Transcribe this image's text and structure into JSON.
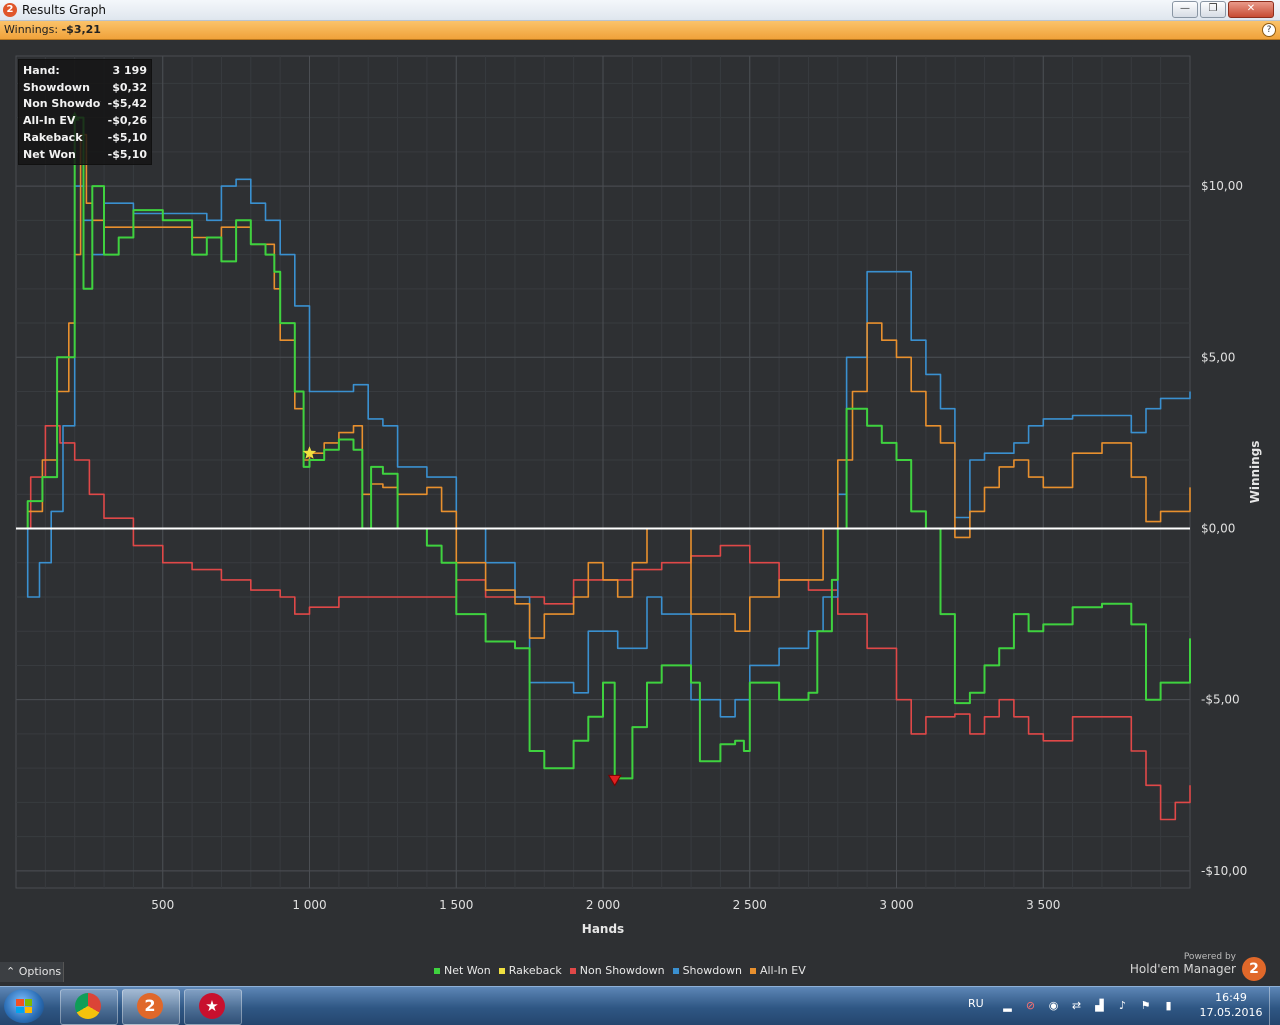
{
  "window": {
    "title": "Results Graph",
    "app_icon": "2"
  },
  "window_buttons": {
    "minimize": "—",
    "maximize": "❐",
    "close": "✕"
  },
  "info": {
    "label": "Winnings:",
    "value": "-$3,21"
  },
  "tooltip": {
    "rows": [
      {
        "label": "Hand:",
        "value": "3 199"
      },
      {
        "label": "Showdown",
        "value": "$0,32"
      },
      {
        "label": "Non Showdown",
        "value": "-$5,42"
      },
      {
        "label": "All-In EV",
        "value": "-$0,26"
      },
      {
        "label": "Rakeback",
        "value": "-$5,10"
      },
      {
        "label": "Net Won",
        "value": "-$5,10"
      }
    ]
  },
  "chart_data": {
    "type": "line",
    "xlabel": "Hands",
    "ylabel": "Winnings",
    "x_ticks": [
      "500",
      "1 000",
      "1 500",
      "2 000",
      "2 500",
      "3 000",
      "3 500"
    ],
    "y_ticks": [
      "$10,00",
      "$5,00",
      "$0,00",
      "-$5,00",
      "-$10,00"
    ],
    "xlim": [
      0,
      4000
    ],
    "ylim": [
      -10.5,
      13.8
    ],
    "grid": true,
    "legend_position": "bottom",
    "series": [
      {
        "name": "Net Won",
        "color": "#3fd23f",
        "points": [
          [
            0,
            0
          ],
          [
            40,
            0.8
          ],
          [
            90,
            1.5
          ],
          [
            140,
            5
          ],
          [
            200,
            12
          ],
          [
            230,
            7
          ],
          [
            260,
            10
          ],
          [
            300,
            8
          ],
          [
            350,
            8.5
          ],
          [
            400,
            9.3
          ],
          [
            500,
            9
          ],
          [
            600,
            8
          ],
          [
            650,
            8.5
          ],
          [
            700,
            7.8
          ],
          [
            750,
            9
          ],
          [
            800,
            8.3
          ],
          [
            850,
            8
          ],
          [
            880,
            7.5
          ],
          [
            900,
            6
          ],
          [
            950,
            4
          ],
          [
            980,
            1.8
          ],
          [
            1000,
            2
          ],
          [
            1050,
            2.3
          ],
          [
            1100,
            2.6
          ],
          [
            1150,
            2.3
          ],
          [
            1180,
            0
          ],
          [
            1210,
            1.8
          ],
          [
            1250,
            1.6
          ],
          [
            1300,
            0
          ],
          [
            1400,
            -0.5
          ],
          [
            1450,
            -1
          ],
          [
            1500,
            -2.5
          ],
          [
            1600,
            -3.3
          ],
          [
            1700,
            -3.5
          ],
          [
            1750,
            -6.5
          ],
          [
            1800,
            -7
          ],
          [
            1900,
            -6.2
          ],
          [
            1950,
            -5.5
          ],
          [
            2000,
            -4.5
          ],
          [
            2040,
            -7.3
          ],
          [
            2100,
            -5.8
          ],
          [
            2150,
            -4.5
          ],
          [
            2200,
            -4
          ],
          [
            2300,
            -4.5
          ],
          [
            2330,
            -6.8
          ],
          [
            2400,
            -6.3
          ],
          [
            2450,
            -6.2
          ],
          [
            2480,
            -6.5
          ],
          [
            2500,
            -4.5
          ],
          [
            2600,
            -5
          ],
          [
            2700,
            -4.8
          ],
          [
            2730,
            -3
          ],
          [
            2780,
            -1.5
          ],
          [
            2800,
            0
          ],
          [
            2830,
            3.5
          ],
          [
            2900,
            3
          ],
          [
            2950,
            2.5
          ],
          [
            3000,
            2
          ],
          [
            3050,
            0.5
          ],
          [
            3100,
            0
          ],
          [
            3150,
            -2.5
          ],
          [
            3199,
            -5.1
          ],
          [
            3250,
            -4.8
          ],
          [
            3300,
            -4
          ],
          [
            3350,
            -3.5
          ],
          [
            3400,
            -2.5
          ],
          [
            3450,
            -3
          ],
          [
            3500,
            -2.8
          ],
          [
            3600,
            -2.3
          ],
          [
            3700,
            -2.2
          ],
          [
            3800,
            -2.8
          ],
          [
            3850,
            -5
          ],
          [
            3900,
            -4.5
          ],
          [
            4000,
            -3.21
          ]
        ]
      },
      {
        "name": "Rakeback",
        "color": "#f0e040",
        "points": []
      },
      {
        "name": "Non Showdown",
        "color": "#e04848",
        "points": [
          [
            0,
            0
          ],
          [
            50,
            1.5
          ],
          [
            100,
            3
          ],
          [
            150,
            2.5
          ],
          [
            200,
            2
          ],
          [
            250,
            1
          ],
          [
            300,
            0.3
          ],
          [
            400,
            -0.5
          ],
          [
            500,
            -1
          ],
          [
            600,
            -1.2
          ],
          [
            700,
            -1.5
          ],
          [
            800,
            -1.8
          ],
          [
            900,
            -2
          ],
          [
            950,
            -2.5
          ],
          [
            1000,
            -2.3
          ],
          [
            1100,
            -2
          ],
          [
            1200,
            -2
          ],
          [
            1300,
            -2
          ],
          [
            1400,
            -2
          ],
          [
            1500,
            -1.5
          ],
          [
            1600,
            -2
          ],
          [
            1700,
            -2
          ],
          [
            1800,
            -2.2
          ],
          [
            1900,
            -1.5
          ],
          [
            2000,
            -1.5
          ],
          [
            2100,
            -1.2
          ],
          [
            2200,
            -1
          ],
          [
            2300,
            -0.8
          ],
          [
            2400,
            -0.5
          ],
          [
            2500,
            -1
          ],
          [
            2600,
            -1.5
          ],
          [
            2700,
            -1.8
          ],
          [
            2800,
            -2.5
          ],
          [
            2900,
            -3.5
          ],
          [
            3000,
            -5
          ],
          [
            3050,
            -6
          ],
          [
            3100,
            -5.5
          ],
          [
            3199,
            -5.42
          ],
          [
            3250,
            -6
          ],
          [
            3300,
            -5.5
          ],
          [
            3350,
            -5
          ],
          [
            3400,
            -5.5
          ],
          [
            3450,
            -6
          ],
          [
            3500,
            -6.2
          ],
          [
            3600,
            -5.5
          ],
          [
            3700,
            -5.5
          ],
          [
            3800,
            -6.5
          ],
          [
            3850,
            -7.5
          ],
          [
            3900,
            -8.5
          ],
          [
            3950,
            -8
          ],
          [
            4000,
            -7.5
          ]
        ]
      },
      {
        "name": "Showdown",
        "color": "#3a90d0",
        "points": [
          [
            0,
            0
          ],
          [
            40,
            -2
          ],
          [
            80,
            -1
          ],
          [
            120,
            0.5
          ],
          [
            160,
            3
          ],
          [
            200,
            10
          ],
          [
            230,
            9
          ],
          [
            260,
            8
          ],
          [
            300,
            9.5
          ],
          [
            400,
            9.2
          ],
          [
            500,
            9.2
          ],
          [
            600,
            9.2
          ],
          [
            650,
            9
          ],
          [
            700,
            10
          ],
          [
            750,
            10.2
          ],
          [
            800,
            9.5
          ],
          [
            850,
            9
          ],
          [
            900,
            8
          ],
          [
            950,
            6.5
          ],
          [
            1000,
            4
          ],
          [
            1100,
            4
          ],
          [
            1150,
            4.2
          ],
          [
            1200,
            3.2
          ],
          [
            1250,
            3
          ],
          [
            1300,
            1.8
          ],
          [
            1400,
            1.5
          ],
          [
            1450,
            1.5
          ],
          [
            1500,
            0
          ],
          [
            1600,
            -1
          ],
          [
            1700,
            -2
          ],
          [
            1750,
            -4.5
          ],
          [
            1850,
            -4.5
          ],
          [
            1900,
            -4.8
          ],
          [
            1950,
            -3
          ],
          [
            2000,
            -3
          ],
          [
            2050,
            -3.5
          ],
          [
            2100,
            -3.5
          ],
          [
            2150,
            -2
          ],
          [
            2200,
            -2.5
          ],
          [
            2300,
            -5
          ],
          [
            2400,
            -5.5
          ],
          [
            2450,
            -5
          ],
          [
            2500,
            -4
          ],
          [
            2600,
            -3.5
          ],
          [
            2700,
            -3
          ],
          [
            2750,
            -2
          ],
          [
            2800,
            1
          ],
          [
            2830,
            5
          ],
          [
            2900,
            7.5
          ],
          [
            3000,
            7.5
          ],
          [
            3050,
            5.5
          ],
          [
            3100,
            4.5
          ],
          [
            3150,
            3.5
          ],
          [
            3199,
            0.32
          ],
          [
            3250,
            2
          ],
          [
            3300,
            2.2
          ],
          [
            3350,
            2.2
          ],
          [
            3400,
            2.5
          ],
          [
            3450,
            3
          ],
          [
            3500,
            3.2
          ],
          [
            3600,
            3.3
          ],
          [
            3700,
            3.3
          ],
          [
            3800,
            2.8
          ],
          [
            3850,
            3.5
          ],
          [
            3900,
            3.8
          ],
          [
            4000,
            4
          ]
        ]
      },
      {
        "name": "All-In EV",
        "color": "#e8902e",
        "points": [
          [
            0,
            0
          ],
          [
            40,
            0.5
          ],
          [
            90,
            2
          ],
          [
            140,
            4
          ],
          [
            180,
            6
          ],
          [
            200,
            8
          ],
          [
            220,
            11.5
          ],
          [
            240,
            9.5
          ],
          [
            260,
            9
          ],
          [
            300,
            8.8
          ],
          [
            400,
            8.8
          ],
          [
            500,
            8.8
          ],
          [
            600,
            8.5
          ],
          [
            700,
            8.8
          ],
          [
            800,
            8.3
          ],
          [
            850,
            8.3
          ],
          [
            880,
            7
          ],
          [
            900,
            5.5
          ],
          [
            950,
            3.5
          ],
          [
            980,
            2
          ],
          [
            1000,
            2.2
          ],
          [
            1050,
            2.5
          ],
          [
            1100,
            2.8
          ],
          [
            1150,
            3
          ],
          [
            1180,
            1
          ],
          [
            1210,
            1.3
          ],
          [
            1250,
            1.2
          ],
          [
            1300,
            1
          ],
          [
            1400,
            1.2
          ],
          [
            1450,
            0.5
          ],
          [
            1500,
            -1
          ],
          [
            1600,
            -1.8
          ],
          [
            1700,
            -2.2
          ],
          [
            1750,
            -3.2
          ],
          [
            1800,
            -2.5
          ],
          [
            1900,
            -2
          ],
          [
            1950,
            -1
          ],
          [
            2000,
            -1.5
          ],
          [
            2050,
            -2
          ],
          [
            2100,
            -1
          ],
          [
            2150,
            0
          ],
          [
            2200,
            0
          ],
          [
            2300,
            -2.5
          ],
          [
            2400,
            -2.5
          ],
          [
            2450,
            -3
          ],
          [
            2500,
            -2
          ],
          [
            2600,
            -1.5
          ],
          [
            2700,
            -1.5
          ],
          [
            2750,
            0
          ],
          [
            2800,
            2
          ],
          [
            2850,
            4
          ],
          [
            2900,
            6
          ],
          [
            2950,
            5.5
          ],
          [
            3000,
            5
          ],
          [
            3050,
            4
          ],
          [
            3100,
            3
          ],
          [
            3150,
            2.5
          ],
          [
            3199,
            -0.26
          ],
          [
            3250,
            0.5
          ],
          [
            3300,
            1.2
          ],
          [
            3350,
            1.8
          ],
          [
            3400,
            2
          ],
          [
            3450,
            1.5
          ],
          [
            3500,
            1.2
          ],
          [
            3600,
            2.2
          ],
          [
            3700,
            2.5
          ],
          [
            3800,
            1.5
          ],
          [
            3850,
            0.2
          ],
          [
            3900,
            0.5
          ],
          [
            4000,
            1.2
          ]
        ]
      }
    ],
    "markers": [
      {
        "type": "max",
        "color": "#2ec02e",
        "x": 200,
        "y": 12
      },
      {
        "type": "min",
        "color": "#e02020",
        "x": 2040,
        "y": -7.3
      },
      {
        "type": "star",
        "color": "#f0e040",
        "x": 1000,
        "y": 2.2
      }
    ]
  },
  "options": {
    "label": "Options",
    "icon": "caret-up-icon"
  },
  "powered": {
    "line1": "Powered by",
    "line2": "Hold'em Manager",
    "logo": "2"
  },
  "taskbar": {
    "apps": [
      "Chrome",
      "Hold'em Manager 2",
      "PokerStars"
    ],
    "language": "RU",
    "time": "16:49",
    "date": "17.05.2016"
  }
}
